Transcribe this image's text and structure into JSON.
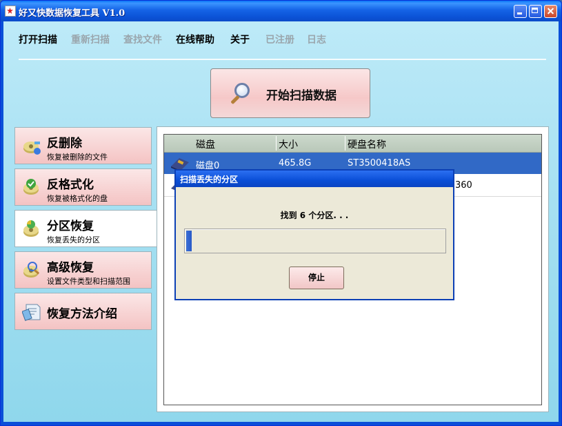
{
  "window": {
    "title": "好又快数据恢复工具 V1.0"
  },
  "menu": [
    {
      "label": "打开扫描",
      "enabled": true
    },
    {
      "label": "重新扫描",
      "enabled": false
    },
    {
      "label": "查找文件",
      "enabled": false
    },
    {
      "label": "在线帮助",
      "enabled": true
    },
    {
      "label": "关于",
      "enabled": true
    },
    {
      "label": "已注册",
      "enabled": false
    },
    {
      "label": "日志",
      "enabled": false
    }
  ],
  "scan_button": {
    "label": "开始扫描数据",
    "icon": "magnifier-icon"
  },
  "sidebar": [
    {
      "title": "反删除",
      "subtitle": "恢复被删除的文件",
      "icon": "undelete-icon",
      "selected": false
    },
    {
      "title": "反格式化",
      "subtitle": "恢复被格式化的盘",
      "icon": "unformat-icon",
      "selected": false
    },
    {
      "title": "分区恢复",
      "subtitle": "恢复丢失的分区",
      "icon": "partition-icon",
      "selected": true
    },
    {
      "title": "高级恢复",
      "subtitle": "设置文件类型和扫描范围",
      "icon": "advanced-icon",
      "selected": false
    },
    {
      "title": "恢复方法介绍",
      "subtitle": "",
      "icon": "guide-icon",
      "selected": false
    }
  ],
  "disk_table": {
    "columns": [
      "磁盘",
      "大小",
      "硬盘名称"
    ],
    "rows": [
      {
        "disk": "磁盘0",
        "size": "465.8G",
        "name": "ST3500418AS",
        "selected": true
      },
      {
        "disk": "",
        "size": "",
        "name": "360",
        "selected": false
      }
    ]
  },
  "dialog": {
    "title": "扫描丢失的分区",
    "message": "找到 6 个分区. . .",
    "progress": 0.02,
    "stop_label": "停止"
  },
  "colors": {
    "accent": "#3169c6",
    "titlebar": "#0a4fd8",
    "client_bg": "#a6e0f2",
    "disabled": "#9aa6ad"
  }
}
